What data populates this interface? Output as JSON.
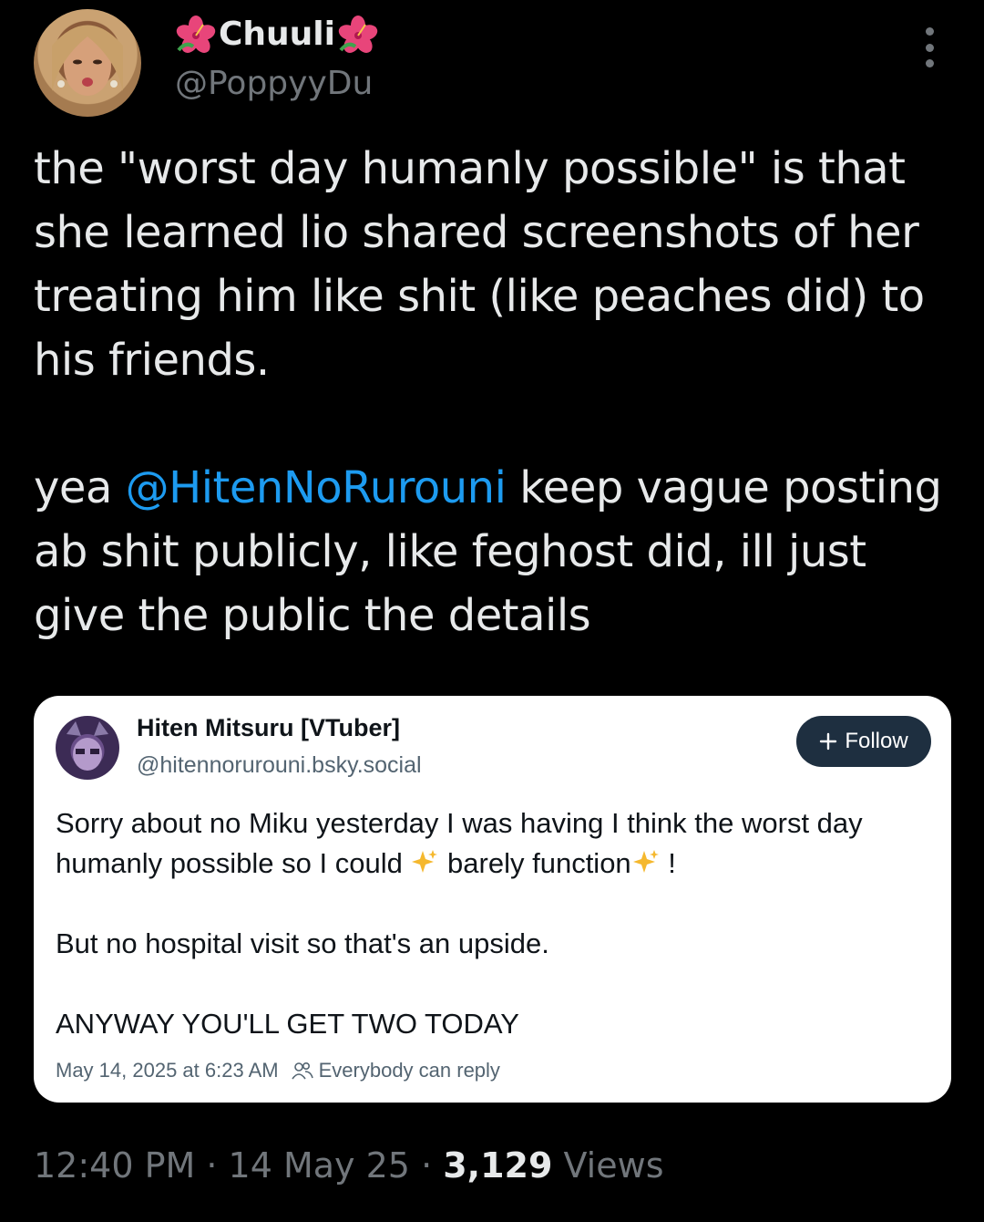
{
  "author": {
    "display_name": "Chuuli",
    "name_decoration_icon": "hibiscus-icon",
    "handle": "@PoppyyDu"
  },
  "tweet": {
    "line1_pre": "the \"worst day humanly possible\" is that she learned lio shared screenshots of her treating him like shit (like peaches did) to his friends.",
    "para2_pre": "yea ",
    "para2_mention": "@HitenNoRurouni",
    "para2_post": " keep vague posting ab shit publicly, like feghost did, ill just give the public the details"
  },
  "quoted": {
    "display_name": "Hiten Mitsuru [VTuber]",
    "handle": "@hitennorurouni.bsky.social",
    "follow_label": "Follow",
    "follow_icon": "plus-icon",
    "para1_a": "Sorry about no Miku yesterday I was having I think the worst day humanly possible so I could ",
    "para1_b": " barely function",
    "para1_c": " !",
    "sparkle_icon": "sparkles-icon",
    "para2": "But no hospital visit so that's an upside.",
    "para3": "ANYWAY YOU'LL GET TWO TODAY",
    "timestamp": "May 14, 2025 at 6:23 AM",
    "reply_icon": "people-icon",
    "reply_setting": "Everybody can reply"
  },
  "meta": {
    "time": "12:40 PM",
    "sep": " · ",
    "date": "14 May 25",
    "views_count": "3,129",
    "views_label": " Views"
  },
  "colors": {
    "background": "#000000",
    "text": "#e7e9ea",
    "secondary": "#71767b",
    "mention": "#1d9bf0",
    "follow_button": "#1e2f40"
  }
}
